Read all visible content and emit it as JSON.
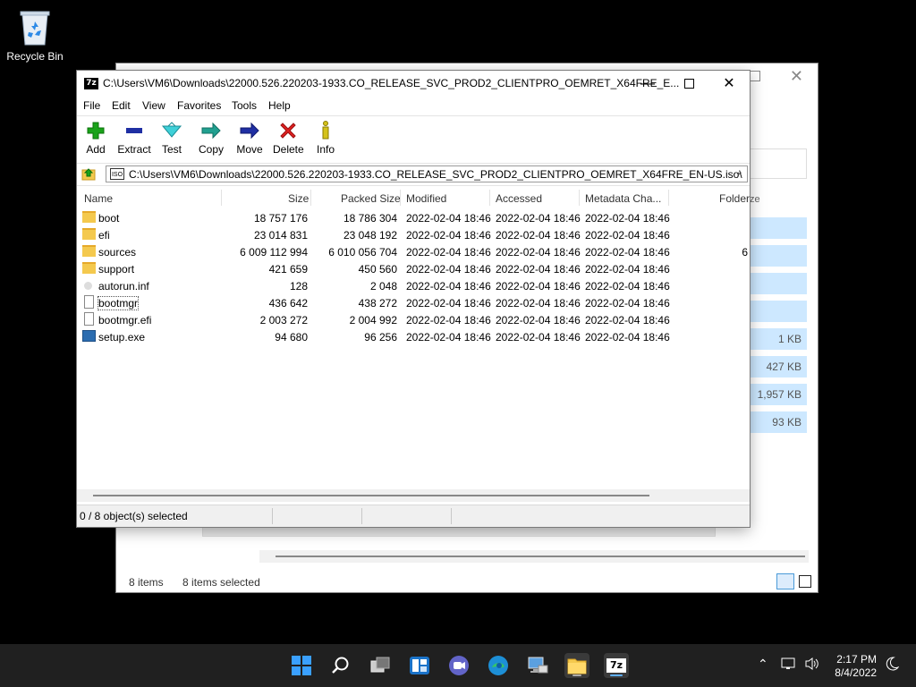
{
  "desktop": {
    "recycle_bin_label": "Recycle Bin"
  },
  "explorer": {
    "sizes": [
      "1 KB",
      "427 KB",
      "1,957 KB",
      "93 KB"
    ],
    "col_fragment": "ze",
    "status_items": "8 items",
    "status_selected": "8 items selected"
  },
  "sevenzip": {
    "title": "C:\\Users\\VM6\\Downloads\\22000.526.220203-1933.CO_RELEASE_SVC_PROD2_CLIENTPRO_OEMRET_X64FRE_E...",
    "app_icon_text": "7z",
    "menu": [
      "File",
      "Edit",
      "View",
      "Favorites",
      "Tools",
      "Help"
    ],
    "toolbar": [
      "Add",
      "Extract",
      "Test",
      "Copy",
      "Move",
      "Delete",
      "Info"
    ],
    "address": "C:\\Users\\VM6\\Downloads\\22000.526.220203-1933.CO_RELEASE_SVC_PROD2_CLIENTPRO_OEMRET_X64FRE_EN-US.iso\\",
    "iso_label": "ISO",
    "columns": [
      "Name",
      "Size",
      "Packed Size",
      "Modified",
      "Accessed",
      "Metadata Cha...",
      "Folder"
    ],
    "rows": [
      {
        "name": "boot",
        "size": "18 757 176",
        "packed": "18 786 304",
        "modified": "2022-02-04 18:46",
        "accessed": "2022-02-04 18:46",
        "meta": "2022-02-04 18:46",
        "folder": ""
      },
      {
        "name": "efi",
        "size": "23 014 831",
        "packed": "23 048 192",
        "modified": "2022-02-04 18:46",
        "accessed": "2022-02-04 18:46",
        "meta": "2022-02-04 18:46",
        "folder": ""
      },
      {
        "name": "sources",
        "size": "6 009 112 994",
        "packed": "6 010 056 704",
        "modified": "2022-02-04 18:46",
        "accessed": "2022-02-04 18:46",
        "meta": "2022-02-04 18:46",
        "folder": "6"
      },
      {
        "name": "support",
        "size": "421 659",
        "packed": "450 560",
        "modified": "2022-02-04 18:46",
        "accessed": "2022-02-04 18:46",
        "meta": "2022-02-04 18:46",
        "folder": ""
      },
      {
        "name": "autorun.inf",
        "size": "128",
        "packed": "2 048",
        "modified": "2022-02-04 18:46",
        "accessed": "2022-02-04 18:46",
        "meta": "2022-02-04 18:46",
        "folder": ""
      },
      {
        "name": "bootmgr",
        "size": "436 642",
        "packed": "438 272",
        "modified": "2022-02-04 18:46",
        "accessed": "2022-02-04 18:46",
        "meta": "2022-02-04 18:46",
        "folder": ""
      },
      {
        "name": "bootmgr.efi",
        "size": "2 003 272",
        "packed": "2 004 992",
        "modified": "2022-02-04 18:46",
        "accessed": "2022-02-04 18:46",
        "meta": "2022-02-04 18:46",
        "folder": ""
      },
      {
        "name": "setup.exe",
        "size": "94 680",
        "packed": "96 256",
        "modified": "2022-02-04 18:46",
        "accessed": "2022-02-04 18:46",
        "meta": "2022-02-04 18:46",
        "folder": ""
      }
    ],
    "status": "0 / 8 object(s) selected"
  },
  "taskbar": {
    "time": "2:17 PM",
    "date": "8/4/2022",
    "zip_icon_text": "7z"
  }
}
